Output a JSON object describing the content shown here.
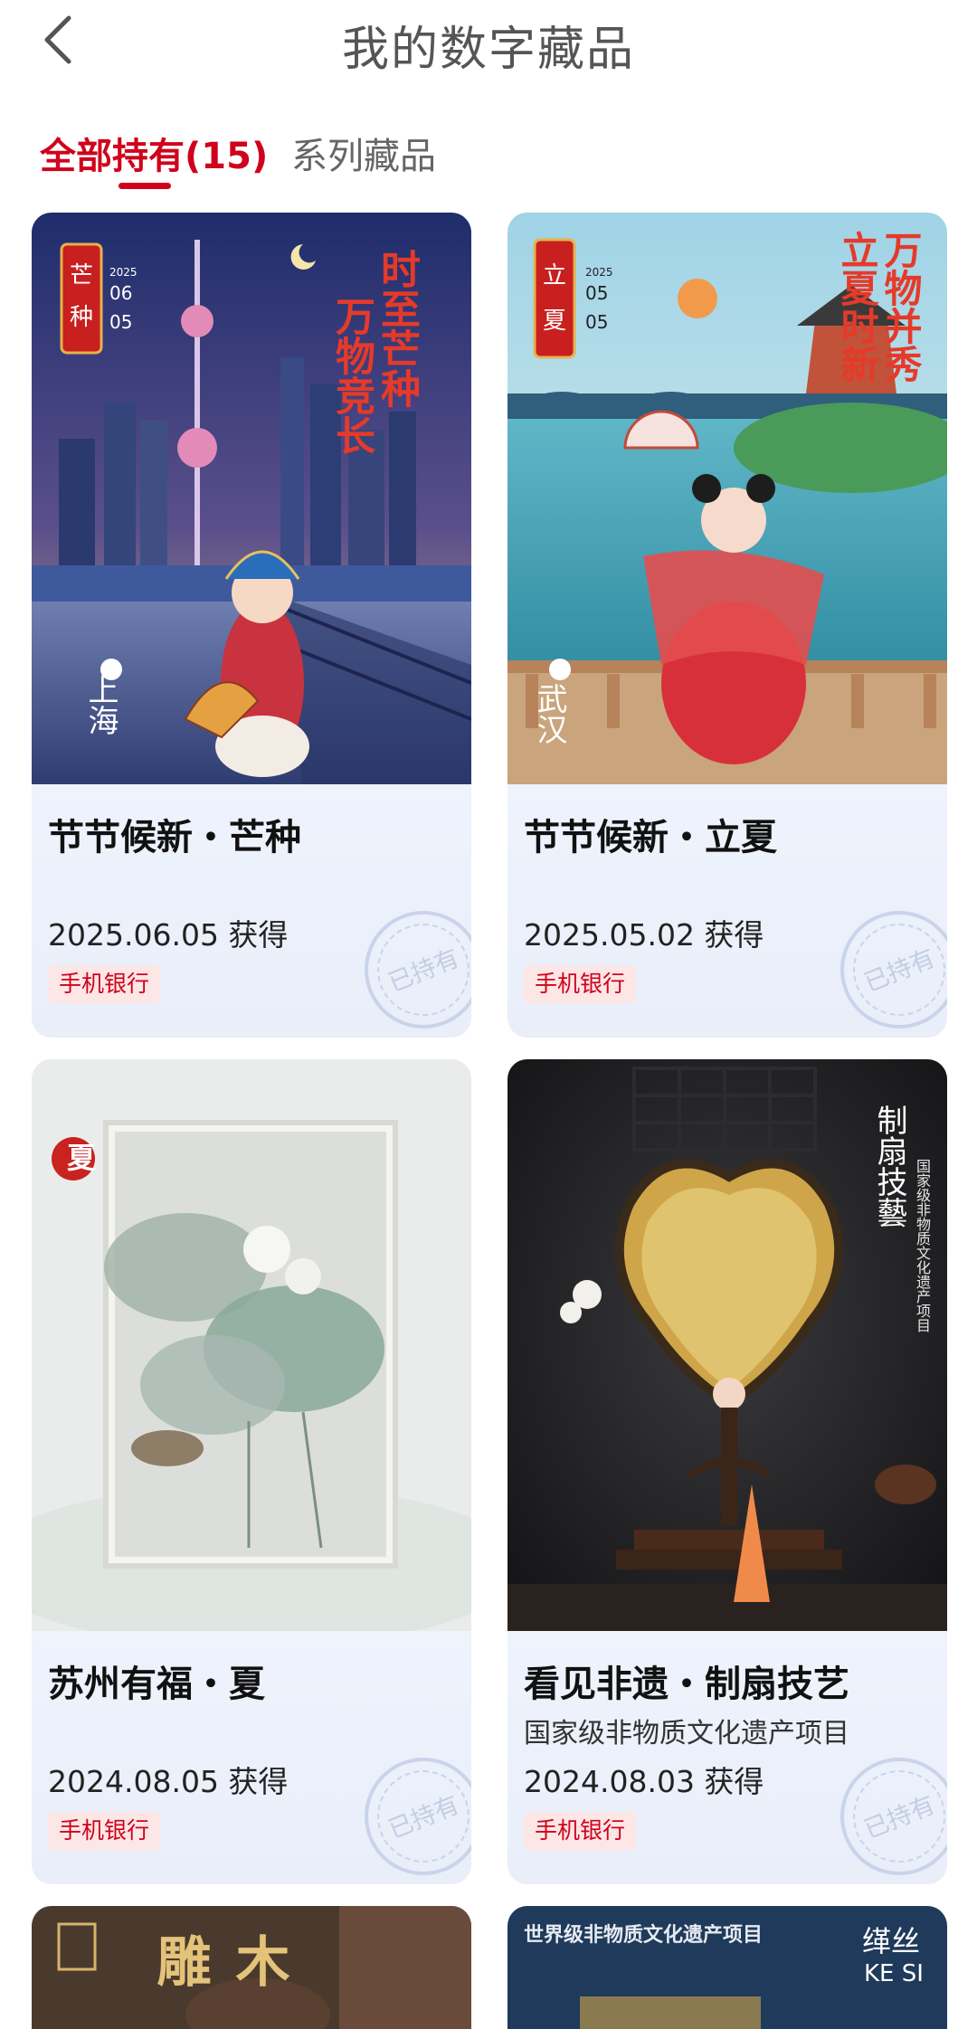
{
  "header": {
    "title": "我的数字藏品"
  },
  "tabs": [
    {
      "label": "全部持有(15)",
      "active": true
    },
    {
      "label": "系列藏品",
      "active": false
    }
  ],
  "accent_color": "#d0021b",
  "cards": [
    {
      "title": "节节候新・芒种",
      "subtitle": "",
      "date": "2025.06.05 获得",
      "tag": "手机银行",
      "stamp": "已持有",
      "art": {
        "seal": "芒种",
        "date_year": "2025",
        "date_m": "06",
        "date_d": "05",
        "slogan_a": "时至芒种",
        "slogan_b": "万物竞长",
        "city": "上海"
      }
    },
    {
      "title": "节节候新・立夏",
      "subtitle": "",
      "date": "2025.05.02 获得",
      "tag": "手机银行",
      "stamp": "已持有",
      "art": {
        "seal": "立夏",
        "date_year": "2025",
        "date_m": "05",
        "date_d": "05",
        "slogan_a": "万物并秀",
        "slogan_b": "立夏时新",
        "city": "武汉"
      }
    },
    {
      "title": "苏州有福・夏",
      "subtitle": "",
      "date": "2024.08.05 获得",
      "tag": "手机银行",
      "stamp": "已持有",
      "art": {
        "seal": "夏"
      }
    },
    {
      "title": "看见非遗・制扇技艺",
      "subtitle": "国家级非物质文化遗产项目",
      "date": "2024.08.03 获得",
      "tag": "手机银行",
      "stamp": "已持有",
      "art": {
        "heading": "制扇技藝",
        "caption": "国家级非物质文化遗产项目"
      }
    },
    {
      "title": "",
      "art": {
        "heading": "木雕"
      }
    },
    {
      "title": "",
      "art": {
        "banner": "世界级非物质文化遗产项目",
        "cn": "缂丝",
        "en": "KE SI"
      }
    }
  ]
}
